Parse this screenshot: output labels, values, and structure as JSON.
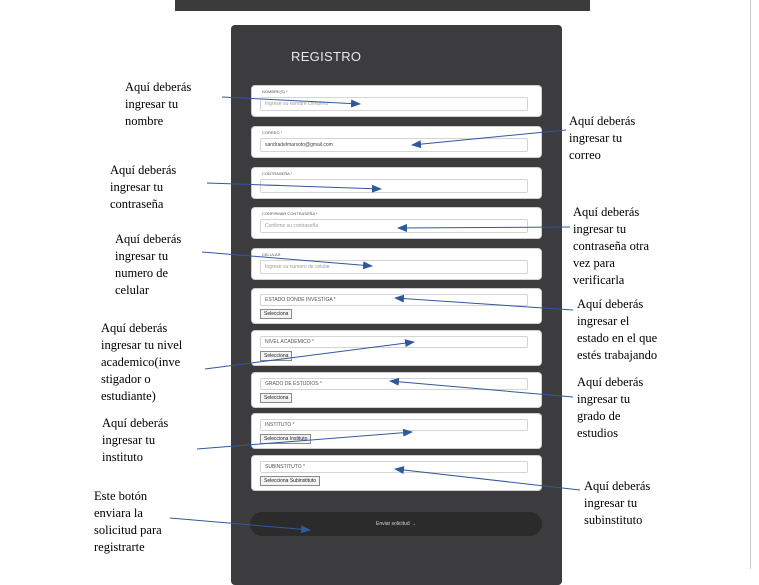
{
  "form": {
    "title": "REGISTRO",
    "fields": [
      {
        "label": "NOMBRE(S) *",
        "value": "Ingrese su nombre completo",
        "placeholder": true
      },
      {
        "label": "CORREO *",
        "value": "sandradelmarsoto@gmail.com",
        "placeholder": false
      },
      {
        "label": "CONTRASEÑA *",
        "value": "••••••••",
        "placeholder": true
      },
      {
        "label": "CONFIRMAR CONTRASEÑA *",
        "value": "Confirme su contraseña",
        "placeholder": true
      },
      {
        "label": "CELULAR",
        "value": "Ingrese su numero de celular",
        "placeholder": true
      }
    ],
    "selects": [
      {
        "label": "ESTADO DONDE INVESTIGA *",
        "value": "Selecciona"
      },
      {
        "label": "NIVEL ACADEMICO *",
        "value": "Selecciona"
      },
      {
        "label": "GRADO DE ESTUDIOS *",
        "value": "Selecciona"
      },
      {
        "label": "INSTITUTO *",
        "value": "Selecciona Instituto"
      },
      {
        "label": "SUBINSTITUTO *",
        "value": "Selecciona Subinstituto"
      }
    ],
    "submit_label": "Enviar solicitud →"
  },
  "annotations": {
    "nombre": "Aquí deberás\ningresar tu\nnombre",
    "correo": "Aquí deberás\ningresar tu\ncorreo",
    "contrasena": "Aquí deberás\ningresar tu\ncontraseña",
    "confirmar": "Aquí deberás\ningresar tu\ncontraseña otra\nvez para\nverificarla",
    "celular": "Aquí deberás\ningresar tu\nnumero de\ncelular",
    "estado": "Aquí deberás\ningresar el\nestado en el que\nestés trabajando",
    "nivel": "Aquí deberás\ningresar tu nivel\nacademico(inve\nstigador o\nestudiante)",
    "grado": "Aquí deberás\ningresar tu\ngrado de\nestudios",
    "instituto": "Aquí deberás\ningresar tu\ninstituto",
    "subinstituto": "Aquí deberás\ningresar tu\nsubinstituto",
    "boton": "Este botón\nenviara la\nsolicitud para\nregistrarte"
  },
  "colors": {
    "panel": "#3c3c3e",
    "arrow": "#2e5a9c"
  }
}
